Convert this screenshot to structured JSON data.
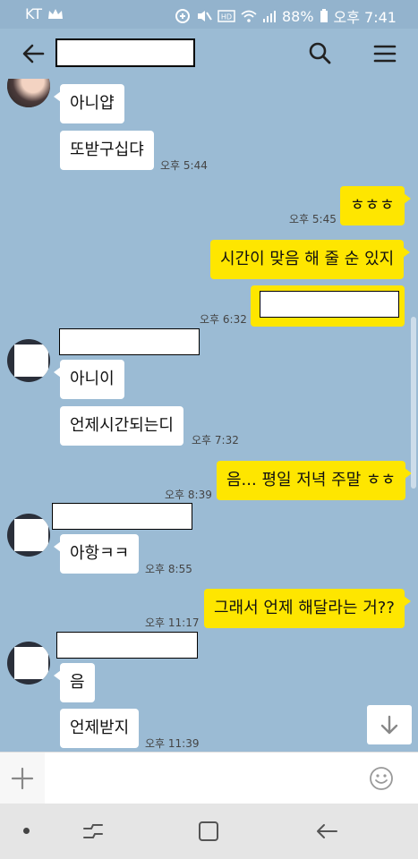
{
  "status": {
    "carrier": "KT",
    "battery": "88%",
    "time": "오후 7:41"
  },
  "header": {
    "title_redacted": ""
  },
  "messages": {
    "m1": "아니얍",
    "m2": "또받구십댜",
    "t2": "오후 5:44",
    "m3": "ㅎㅎㅎ",
    "t3": "오후 5:45",
    "m4": "시간이 맞음 해 줄 순 있지",
    "t5": "오후 6:32",
    "m6": "아니이",
    "m7": "언제시간되는디",
    "t7": "오후 7:32",
    "m8": "음... 평일 저녁 주말 ㅎㅎ",
    "t8": "오후 8:39",
    "m9": "아항ㅋㅋ",
    "t9": "오후 8:55",
    "m10": "그래서 언제 해달라는 거??",
    "t10": "오후 11:17",
    "m11": "음",
    "m12": "언제받지",
    "t12": "오후 11:39"
  },
  "input": {
    "hash_label": "#"
  },
  "colors": {
    "chat_background": "#9bbbd4",
    "outgoing_bubble": "#fee600",
    "incoming_bubble": "#ffffff"
  },
  "icons": {
    "back": "back-arrow-icon",
    "search": "search-icon",
    "menu": "menu-icon",
    "scroll_down": "arrow-down-icon",
    "plus": "plus-icon",
    "emoji": "emoji-icon"
  }
}
